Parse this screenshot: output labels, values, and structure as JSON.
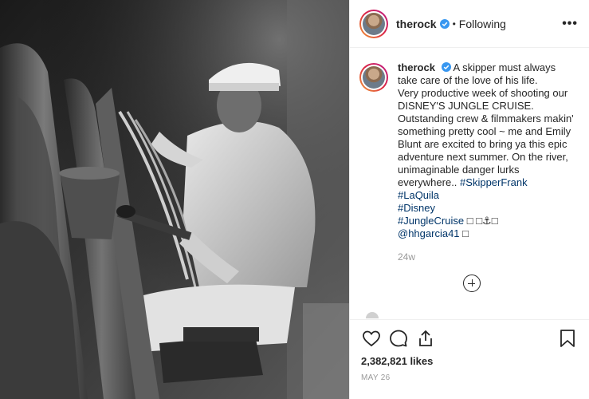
{
  "header": {
    "username": "therock",
    "separator": "•",
    "follow_status": "Following",
    "more_label": "•••"
  },
  "caption": {
    "username": "therock",
    "lines": [
      "A skipper must always take care of the love of his life.",
      "Very productive week of shooting our DISNEY'S JUNGLE CRUISE. Outstanding crew & filmmakers makin' something pretty cool ~ me and Emily Blunt are excited to bring ya this epic adventure next summer. On the river, unimaginable danger lurks everywhere.. "
    ],
    "hashtags": [
      "#SkipperFrank",
      "#LaQuila",
      "#Disney",
      "#JungleCruise"
    ],
    "emoji_after_jungle": "□ □⚓□",
    "mention": "@hhgarcia41",
    "emoji_after_mention": "□",
    "age": "24w"
  },
  "footer": {
    "likes": "2,382,821 likes",
    "date": "MAY 26"
  },
  "icons": {
    "like": "heart-outline-icon",
    "comment": "comment-bubble-icon",
    "share": "share-arrow-icon",
    "save": "bookmark-outline-icon",
    "more": "ellipsis-icon",
    "verified": "verified-badge-icon",
    "load_more": "plus-circle-icon"
  },
  "colors": {
    "link": "#003569",
    "verified": "#3897f0",
    "muted": "#999999",
    "text": "#262626",
    "border": "#efefef"
  }
}
